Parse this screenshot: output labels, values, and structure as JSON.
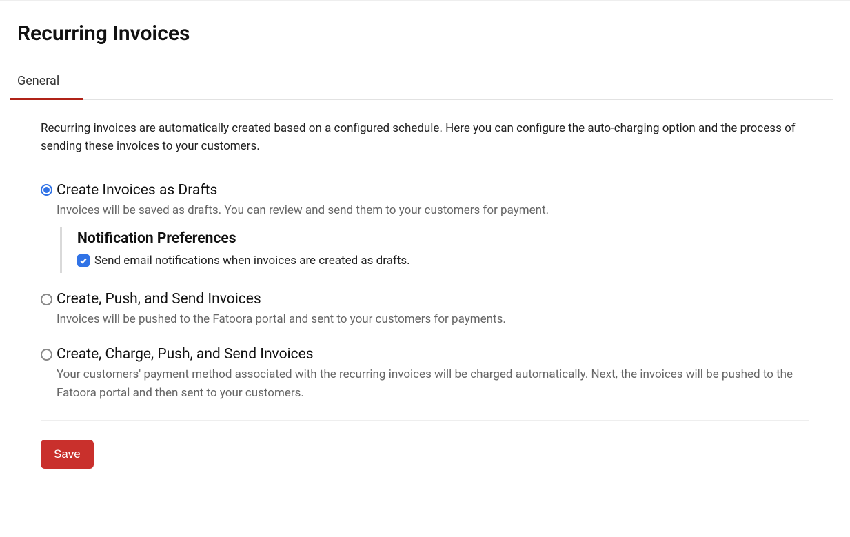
{
  "page": {
    "title": "Recurring Invoices"
  },
  "tabs": {
    "general": "General"
  },
  "intro": "Recurring invoices are automatically created based on a configured schedule. Here you can configure the auto-charging option and the process of sending these invoices to your customers.",
  "options": {
    "drafts": {
      "label": "Create Invoices as Drafts",
      "desc": "Invoices will be saved as drafts. You can review and send them to your customers for payment.",
      "selected": true
    },
    "push_send": {
      "label": "Create, Push, and Send Invoices",
      "desc": "Invoices will be pushed to the Fatoora portal and sent to your customers for payments.",
      "selected": false
    },
    "charge_push_send": {
      "label": "Create, Charge, Push, and Send Invoices",
      "desc": "Your customers' payment method associated with the recurring invoices will be charged automatically. Next, the invoices will be pushed to the Fatoora portal and then sent to your customers.",
      "selected": false
    }
  },
  "notification": {
    "title": "Notification Preferences",
    "email_label": "Send email notifications when invoices are created as drafts.",
    "email_checked": true
  },
  "buttons": {
    "save": "Save"
  }
}
